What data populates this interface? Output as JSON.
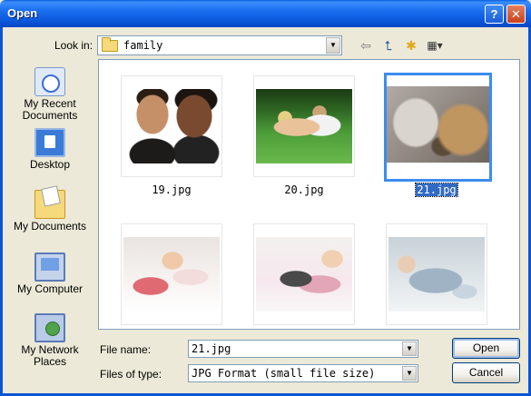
{
  "window": {
    "title": "Open",
    "help_label": "?",
    "close_label": "✕"
  },
  "lookin": {
    "label": "Look in:",
    "value": "family"
  },
  "toolbar": {
    "back_icon": "back-arrow-icon",
    "up_icon": "up-folder-icon",
    "new_folder_icon": "new-folder-icon",
    "views_icon": "views-menu-icon"
  },
  "places": [
    {
      "label": "My Recent Documents",
      "icon": "recent-documents-icon"
    },
    {
      "label": "Desktop",
      "icon": "desktop-icon"
    },
    {
      "label": "My Documents",
      "icon": "my-documents-icon"
    },
    {
      "label": "My Computer",
      "icon": "my-computer-icon"
    },
    {
      "label": "My Network Places",
      "icon": "network-places-icon"
    }
  ],
  "files": [
    {
      "name": "19.jpg",
      "selected": false
    },
    {
      "name": "20.jpg",
      "selected": false
    },
    {
      "name": "21.jpg",
      "selected": true
    },
    {
      "name": "",
      "selected": false
    },
    {
      "name": "",
      "selected": false
    },
    {
      "name": "",
      "selected": false
    }
  ],
  "filename": {
    "label": "File name:",
    "value": "21.jpg"
  },
  "filetype": {
    "label": "Files of type:",
    "value": "JPG Format (small file size)"
  },
  "buttons": {
    "open": "Open",
    "cancel": "Cancel"
  },
  "colors": {
    "titlebar": "#0b58db",
    "selection": "#316ac5",
    "thumb_selected_border": "#3b8cf0",
    "dialog_bg": "#ece9d8"
  }
}
